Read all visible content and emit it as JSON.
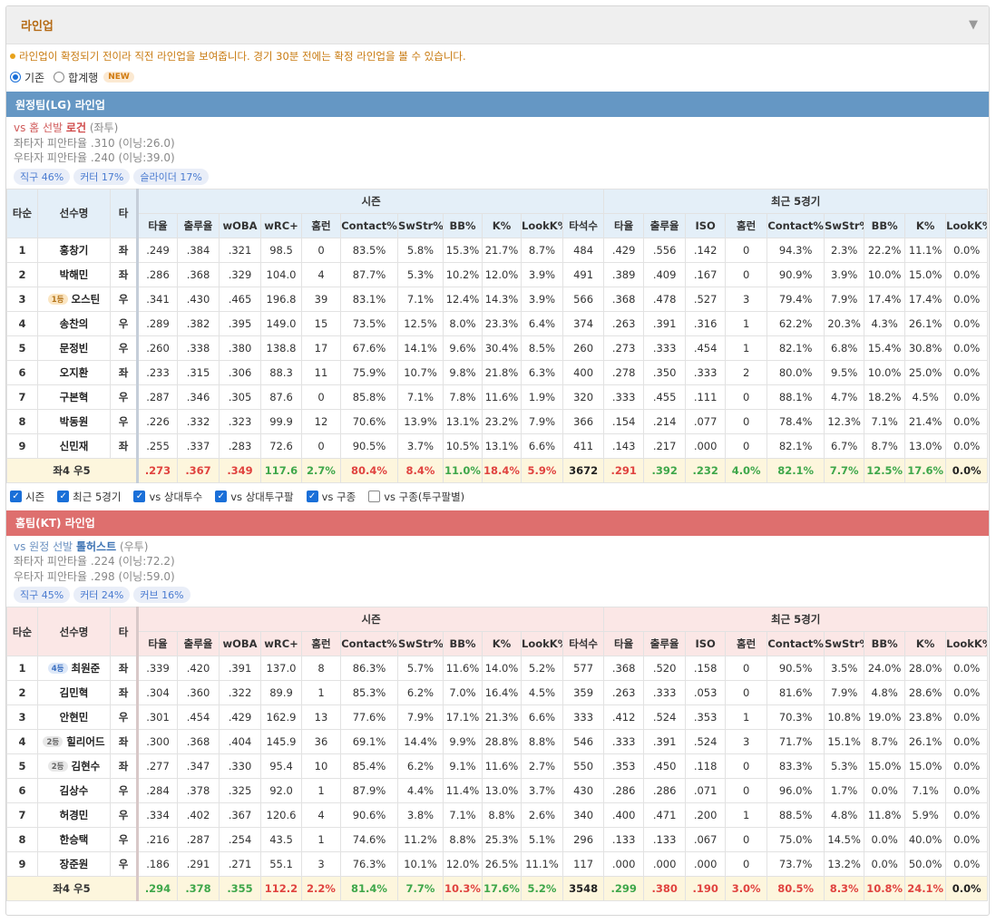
{
  "panel": {
    "title": "라인업"
  },
  "notice": "라인업이 확정되기 전이라 직전 라인업을 보여줍니다. 경기 30분 전에는 확정 라인업을 볼 수 있습니다.",
  "modes": [
    {
      "label": "기존",
      "selected": true
    },
    {
      "label": "합계행",
      "selected": false,
      "badge": "NEW"
    }
  ],
  "headers": {
    "order": "타순",
    "name": "선수명",
    "hand": "타",
    "season": "시즌",
    "recent": "최근 5경기",
    "season_cols": [
      "타율",
      "출루율",
      "wOBA",
      "wRC+",
      "홈런",
      "Contact%",
      "SwStr%",
      "BB%",
      "K%",
      "LookK%",
      "타석수"
    ],
    "recent_cols": [
      "타율",
      "출루율",
      "ISO",
      "홈런",
      "Contact%",
      "SwStr%",
      "BB%",
      "K%",
      "LookK%"
    ]
  },
  "away": {
    "bar": "원정팀(LG) 라인업",
    "sp_prefix": "vs 홈 선발 ",
    "sp_name": "로건",
    "sp_hand": " (좌투)",
    "vs_left": "좌타자 피안타율 .310 (이닝:26.0)",
    "vs_right": "우타자 피안타율 .240 (이닝:39.0)",
    "pitch_tags": [
      "직구 46%",
      "커터 17%",
      "슬라이더 17%"
    ],
    "rows": [
      {
        "order": "1",
        "rank": "",
        "name": "홍창기",
        "hand": "좌",
        "s": [
          ".249",
          ".384",
          ".321",
          "98.5",
          "0",
          "83.5%",
          "5.8%",
          "15.3%",
          "21.7%",
          "8.7%",
          "484"
        ],
        "r": [
          ".429",
          ".556",
          ".142",
          "0",
          "94.3%",
          "2.3%",
          "22.2%",
          "11.1%",
          "0.0%"
        ]
      },
      {
        "order": "2",
        "rank": "",
        "name": "박해민",
        "hand": "좌",
        "s": [
          ".286",
          ".368",
          ".329",
          "104.0",
          "4",
          "87.7%",
          "5.3%",
          "10.2%",
          "12.0%",
          "3.9%",
          "491"
        ],
        "r": [
          ".389",
          ".409",
          ".167",
          "0",
          "90.9%",
          "3.9%",
          "10.0%",
          "15.0%",
          "0.0%"
        ]
      },
      {
        "order": "3",
        "rank": "1등",
        "name": "오스틴",
        "hand": "우",
        "s": [
          ".341",
          ".430",
          ".465",
          "196.8",
          "39",
          "83.1%",
          "7.1%",
          "12.4%",
          "14.3%",
          "3.9%",
          "566"
        ],
        "r": [
          ".368",
          ".478",
          ".527",
          "3",
          "79.4%",
          "7.9%",
          "17.4%",
          "17.4%",
          "0.0%"
        ]
      },
      {
        "order": "4",
        "rank": "",
        "name": "송찬의",
        "hand": "우",
        "s": [
          ".289",
          ".382",
          ".395",
          "149.0",
          "15",
          "73.5%",
          "12.5%",
          "8.0%",
          "23.3%",
          "6.4%",
          "374"
        ],
        "r": [
          ".263",
          ".391",
          ".316",
          "1",
          "62.2%",
          "20.3%",
          "4.3%",
          "26.1%",
          "0.0%"
        ]
      },
      {
        "order": "5",
        "rank": "",
        "name": "문정빈",
        "hand": "우",
        "s": [
          ".260",
          ".338",
          ".380",
          "138.8",
          "17",
          "67.6%",
          "14.1%",
          "9.6%",
          "30.4%",
          "8.5%",
          "260"
        ],
        "r": [
          ".273",
          ".333",
          ".454",
          "1",
          "82.1%",
          "6.8%",
          "15.4%",
          "30.8%",
          "0.0%"
        ]
      },
      {
        "order": "6",
        "rank": "",
        "name": "오지환",
        "hand": "좌",
        "s": [
          ".233",
          ".315",
          ".306",
          "88.3",
          "11",
          "75.9%",
          "10.7%",
          "9.8%",
          "21.8%",
          "6.3%",
          "400"
        ],
        "r": [
          ".278",
          ".350",
          ".333",
          "2",
          "80.0%",
          "9.5%",
          "10.0%",
          "25.0%",
          "0.0%"
        ]
      },
      {
        "order": "7",
        "rank": "",
        "name": "구본혁",
        "hand": "우",
        "s": [
          ".287",
          ".346",
          ".305",
          "87.6",
          "0",
          "85.8%",
          "7.1%",
          "7.8%",
          "11.6%",
          "1.9%",
          "320"
        ],
        "r": [
          ".333",
          ".455",
          ".111",
          "0",
          "88.1%",
          "4.7%",
          "18.2%",
          "4.5%",
          "0.0%"
        ]
      },
      {
        "order": "8",
        "rank": "",
        "name": "박동원",
        "hand": "우",
        "s": [
          ".226",
          ".332",
          ".323",
          "99.9",
          "12",
          "70.6%",
          "13.9%",
          "13.1%",
          "23.2%",
          "7.9%",
          "366"
        ],
        "r": [
          ".154",
          ".214",
          ".077",
          "0",
          "78.4%",
          "12.3%",
          "7.1%",
          "21.4%",
          "0.0%"
        ]
      },
      {
        "order": "9",
        "rank": "",
        "name": "신민재",
        "hand": "좌",
        "s": [
          ".255",
          ".337",
          ".283",
          "72.6",
          "0",
          "90.5%",
          "3.7%",
          "10.5%",
          "13.1%",
          "6.6%",
          "411"
        ],
        "r": [
          ".143",
          ".217",
          ".000",
          "0",
          "82.1%",
          "6.7%",
          "8.7%",
          "13.0%",
          "0.0%"
        ]
      }
    ],
    "summary": {
      "label": "좌4 우5",
      "s": [
        ".273",
        ".367",
        ".349",
        "117.6",
        "2.7%",
        "80.4%",
        "8.4%",
        "11.0%",
        "18.4%",
        "5.9%",
        "3672"
      ],
      "s_color": [
        "red",
        "red",
        "red",
        "green",
        "green",
        "red",
        "red",
        "green",
        "red",
        "red",
        "blk"
      ],
      "r": [
        ".291",
        ".392",
        ".232",
        "4.0%",
        "82.1%",
        "7.7%",
        "12.5%",
        "17.6%",
        "0.0%"
      ],
      "r_color": [
        "red",
        "green",
        "green",
        "green",
        "green",
        "green",
        "green",
        "green",
        "blk"
      ]
    }
  },
  "filters": [
    {
      "label": "시즌",
      "checked": true
    },
    {
      "label": "최근 5경기",
      "checked": true
    },
    {
      "label": "vs 상대투수",
      "checked": true
    },
    {
      "label": "vs 상대투구팔",
      "checked": true
    },
    {
      "label": "vs 구종",
      "checked": true
    },
    {
      "label": "vs 구종(투구팔별)",
      "checked": false
    }
  ],
  "home": {
    "bar": "홈팀(KT) 라인업",
    "sp_prefix": "vs 원정 선발 ",
    "sp_name": "톨허스트",
    "sp_hand": " (우투)",
    "vs_left": "좌타자 피안타율 .224 (이닝:72.2)",
    "vs_right": "우타자 피안타율 .298 (이닝:59.0)",
    "pitch_tags": [
      "직구 45%",
      "커터 24%",
      "커브 16%"
    ],
    "rows": [
      {
        "order": "1",
        "rank": "4등",
        "name": "최원준",
        "hand": "좌",
        "s": [
          ".339",
          ".420",
          ".391",
          "137.0",
          "8",
          "86.3%",
          "5.7%",
          "11.6%",
          "14.0%",
          "5.2%",
          "577"
        ],
        "r": [
          ".368",
          ".520",
          ".158",
          "0",
          "90.5%",
          "3.5%",
          "24.0%",
          "28.0%",
          "0.0%"
        ]
      },
      {
        "order": "2",
        "rank": "",
        "name": "김민혁",
        "hand": "좌",
        "s": [
          ".304",
          ".360",
          ".322",
          "89.9",
          "1",
          "85.3%",
          "6.2%",
          "7.0%",
          "16.4%",
          "4.5%",
          "359"
        ],
        "r": [
          ".263",
          ".333",
          ".053",
          "0",
          "81.6%",
          "7.9%",
          "4.8%",
          "28.6%",
          "0.0%"
        ]
      },
      {
        "order": "3",
        "rank": "",
        "name": "안현민",
        "hand": "우",
        "s": [
          ".301",
          ".454",
          ".429",
          "162.9",
          "13",
          "77.6%",
          "7.9%",
          "17.1%",
          "21.3%",
          "6.6%",
          "333"
        ],
        "r": [
          ".412",
          ".524",
          ".353",
          "1",
          "70.3%",
          "10.8%",
          "19.0%",
          "23.8%",
          "0.0%"
        ]
      },
      {
        "order": "4",
        "rank": "2등",
        "name": "힐리어드",
        "hand": "좌",
        "s": [
          ".300",
          ".368",
          ".404",
          "145.9",
          "36",
          "69.1%",
          "14.4%",
          "9.9%",
          "28.8%",
          "8.8%",
          "546"
        ],
        "r": [
          ".333",
          ".391",
          ".524",
          "3",
          "71.7%",
          "15.1%",
          "8.7%",
          "26.1%",
          "0.0%"
        ]
      },
      {
        "order": "5",
        "rank": "2등",
        "name": "김현수",
        "hand": "좌",
        "s": [
          ".277",
          ".347",
          ".330",
          "95.4",
          "10",
          "85.4%",
          "6.2%",
          "9.1%",
          "11.6%",
          "2.7%",
          "550"
        ],
        "r": [
          ".353",
          ".450",
          ".118",
          "0",
          "83.3%",
          "5.3%",
          "15.0%",
          "15.0%",
          "0.0%"
        ]
      },
      {
        "order": "6",
        "rank": "",
        "name": "김상수",
        "hand": "우",
        "s": [
          ".284",
          ".378",
          ".325",
          "92.0",
          "1",
          "87.9%",
          "4.4%",
          "11.4%",
          "13.0%",
          "3.7%",
          "430"
        ],
        "r": [
          ".286",
          ".286",
          ".071",
          "0",
          "96.0%",
          "1.7%",
          "0.0%",
          "7.1%",
          "0.0%"
        ]
      },
      {
        "order": "7",
        "rank": "",
        "name": "허경민",
        "hand": "우",
        "s": [
          ".334",
          ".402",
          ".367",
          "120.6",
          "4",
          "90.6%",
          "3.8%",
          "7.1%",
          "8.8%",
          "2.6%",
          "340"
        ],
        "r": [
          ".400",
          ".471",
          ".200",
          "1",
          "88.5%",
          "4.8%",
          "11.8%",
          "5.9%",
          "0.0%"
        ]
      },
      {
        "order": "8",
        "rank": "",
        "name": "한승택",
        "hand": "우",
        "s": [
          ".216",
          ".287",
          ".254",
          "43.5",
          "1",
          "74.6%",
          "11.2%",
          "8.8%",
          "25.3%",
          "5.1%",
          "296"
        ],
        "r": [
          ".133",
          ".133",
          ".067",
          "0",
          "75.0%",
          "14.5%",
          "0.0%",
          "40.0%",
          "0.0%"
        ]
      },
      {
        "order": "9",
        "rank": "",
        "name": "장준원",
        "hand": "우",
        "s": [
          ".186",
          ".291",
          ".271",
          "55.1",
          "3",
          "76.3%",
          "10.1%",
          "12.0%",
          "26.5%",
          "11.1%",
          "117"
        ],
        "r": [
          ".000",
          ".000",
          ".000",
          "0",
          "73.7%",
          "13.2%",
          "0.0%",
          "50.0%",
          "0.0%"
        ]
      }
    ],
    "summary": {
      "label": "좌4 우5",
      "s": [
        ".294",
        ".378",
        ".355",
        "112.2",
        "2.2%",
        "81.4%",
        "7.7%",
        "10.3%",
        "17.6%",
        "5.2%",
        "3548"
      ],
      "s_color": [
        "green",
        "green",
        "green",
        "red",
        "red",
        "green",
        "green",
        "red",
        "green",
        "green",
        "blk"
      ],
      "r": [
        ".299",
        ".380",
        ".190",
        "3.0%",
        "80.5%",
        "8.3%",
        "10.8%",
        "24.1%",
        "0.0%"
      ],
      "r_color": [
        "green",
        "red",
        "red",
        "red",
        "red",
        "red",
        "red",
        "red",
        "blk"
      ]
    }
  },
  "colors": {
    "away_bar": "#6597c4",
    "home_bar": "#de6f6e",
    "title": "#b56a14",
    "notice": "#c87a10",
    "red_value": "#e0433f",
    "green_value": "#3ea74a"
  }
}
